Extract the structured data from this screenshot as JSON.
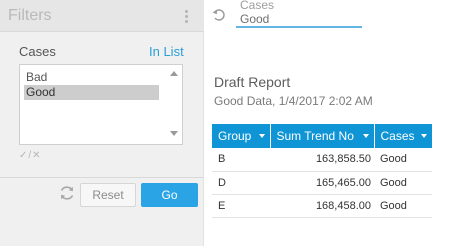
{
  "filters": {
    "title": "Filters",
    "field_label": "Cases",
    "in_list_link": "In List",
    "options": [
      {
        "label": "Bad",
        "selected": false
      },
      {
        "label": "Good",
        "selected": true
      }
    ],
    "check_x": "✓/✕",
    "reset_label": "Reset",
    "go_label": "Go"
  },
  "active_filter": {
    "field": "Cases",
    "value": "Good"
  },
  "report": {
    "title": "Draft Report",
    "subtitle": "Good Data, 1/4/2017 2:02 AM",
    "columns": [
      "Group",
      "Sum Trend No",
      "Cases"
    ],
    "rows": [
      [
        "B",
        "163,858.50",
        "Good"
      ],
      [
        "D",
        "165,465.00",
        "Good"
      ],
      [
        "E",
        "168,458.00",
        "Good"
      ]
    ]
  },
  "colors": {
    "accent": "#2aa4e4",
    "header_bg": "#0f95d6",
    "link": "#2a9fd8"
  }
}
